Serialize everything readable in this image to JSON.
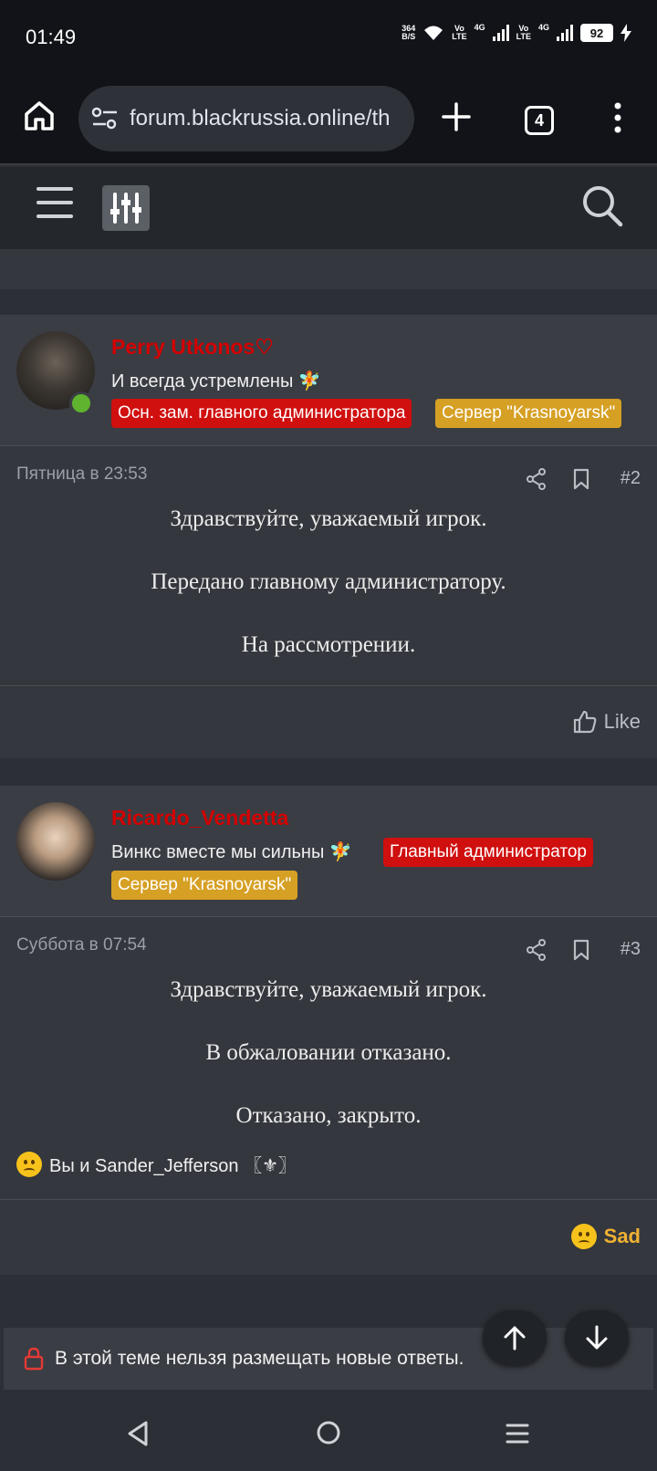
{
  "status_bar": {
    "time": "01:49",
    "net_speed_top": "364",
    "net_speed_bottom": "B/S",
    "volte1": "Vo",
    "volte1b": "LTE",
    "net1": "4G",
    "volte2": "Vo",
    "volte2b": "LTE",
    "net2": "4G",
    "battery": "92"
  },
  "browser": {
    "url": "forum.blackrussia.online/th",
    "tab_count": "4"
  },
  "posts": [
    {
      "username": "Perry Utkonos♡",
      "user_title": "И всегда устремлены 🧚",
      "badges": [
        "Осн. зам. главного администратора",
        "Сервер \"Krasnoyarsk\""
      ],
      "date": "Пятница в 23:53",
      "number": "#2",
      "lines": [
        "Здравствуйте, уважаемый игрок.",
        "Передано главному администратору.",
        "На рассмотрении."
      ],
      "like_label": "Like"
    },
    {
      "username": "Ricardo_Vendetta",
      "user_title": "Винкс вместе мы сильны 🧚",
      "badges": [
        "Главный администратор",
        "Сервер \"Krasnoyarsk\""
      ],
      "date": "Суббота в 07:54",
      "number": "#3",
      "lines": [
        "Здравствуйте, уважаемый игрок.",
        "В обжаловании отказано.",
        "Отказано, закрыто."
      ],
      "reactions_text": "Вы и Sander_Jefferson 〖⚜〗",
      "reaction_label": "Sad"
    }
  ],
  "locked_notice": "В этой теме нельзя размещать новые ответы.",
  "colors": {
    "username": "#d40000",
    "badge_red": "#d00f0f",
    "badge_gold": "#d6a024",
    "sad": "#f0b132"
  }
}
